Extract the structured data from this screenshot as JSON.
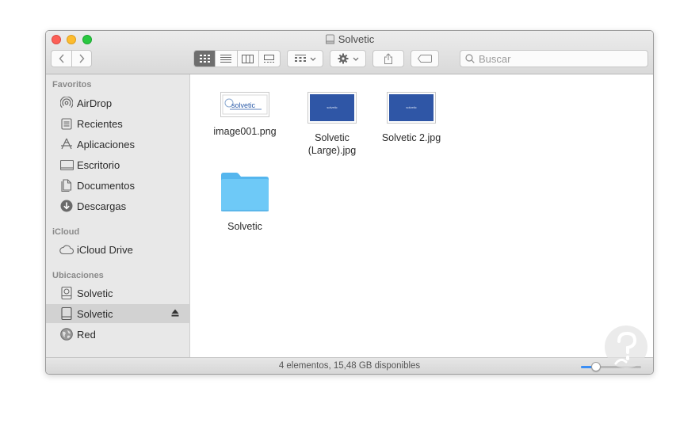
{
  "window": {
    "title": "Solvetic"
  },
  "toolbar": {
    "search_placeholder": "Buscar"
  },
  "sidebar": {
    "favorites_header": "Favoritos",
    "favorites": [
      {
        "label": "AirDrop",
        "icon": "airdrop-icon"
      },
      {
        "label": "Recientes",
        "icon": "recents-icon"
      },
      {
        "label": "Aplicaciones",
        "icon": "applications-icon"
      },
      {
        "label": "Escritorio",
        "icon": "desktop-icon"
      },
      {
        "label": "Documentos",
        "icon": "documents-icon"
      },
      {
        "label": "Descargas",
        "icon": "downloads-icon"
      }
    ],
    "icloud_header": "iCloud",
    "icloud": [
      {
        "label": "iCloud Drive",
        "icon": "cloud-icon"
      }
    ],
    "locations_header": "Ubicaciones",
    "locations": [
      {
        "label": "Solvetic",
        "icon": "internal-disk-icon"
      },
      {
        "label": "Solvetic",
        "icon": "external-disk-icon",
        "selected": true,
        "eject": true
      },
      {
        "label": "Red",
        "icon": "network-icon"
      }
    ]
  },
  "files": [
    {
      "name": "image001.png",
      "type": "image-logo"
    },
    {
      "name": "Solvetic (Large).jpg",
      "type": "image-blue"
    },
    {
      "name": "Solvetic 2.jpg",
      "type": "image-blue"
    },
    {
      "name": "Solvetic",
      "type": "folder"
    }
  ],
  "thumb_text": "solvetic",
  "status": {
    "text": "4 elementos, 15,48 GB disponibles",
    "zoom_fraction": 0.25
  },
  "colors": {
    "accent": "#3a8ef5",
    "folder": "#6ec9f7",
    "thumb_blue": "#2f56a6",
    "selection": "#d2d2d2"
  }
}
